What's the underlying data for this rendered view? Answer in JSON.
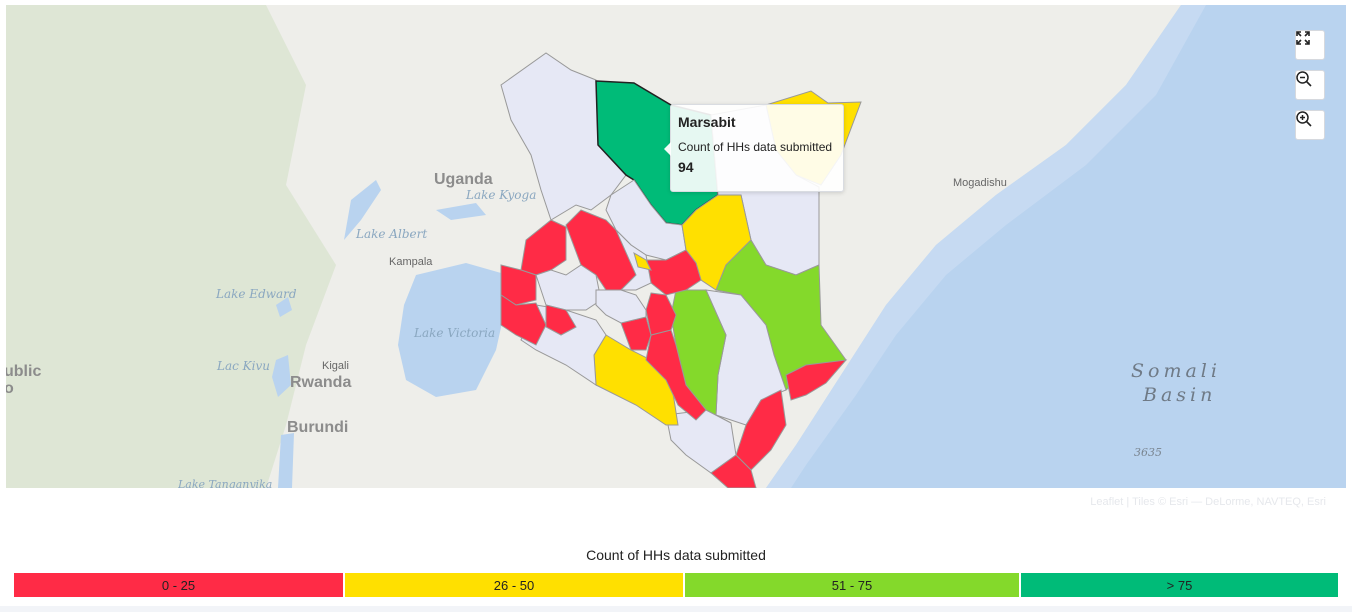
{
  "map": {
    "labels": {
      "uganda": "Uganda",
      "lake_kyoga": "Lake Kyoga",
      "lake_albert": "Lake Albert",
      "kampala": "Kampala",
      "lake_edward": "Lake Edward",
      "lake_victoria": "Lake Victoria",
      "public": "ublic",
      "public2": "o",
      "kigali": "Kigali",
      "rwanda": "Rwanda",
      "lac_kivu": "Lac Kivu",
      "burundi": "Burundi",
      "lake_tanganyika": "Lake Tanganyika",
      "mogadishu": "Mogadishu",
      "somali": "Somali",
      "basin": "Basin",
      "depth": "3635"
    },
    "attribution": "Leaflet | Tiles © Esri — DeLorme, NAVTEQ, Esri",
    "colors": {
      "low": "#ff2b46",
      "mid": "#ffe000",
      "high": "#84d92b",
      "top": "#00bb78",
      "nodata": "#e6e8f5",
      "land": "#eeeeea",
      "water": "#b9d3ef"
    }
  },
  "controls": {
    "fullscreen_icon": "expand-icon",
    "zoom_out_icon": "zoom-out-icon",
    "zoom_in_icon": "zoom-in-icon"
  },
  "tooltip": {
    "title": "Marsabit",
    "label": "Count of HHs data submitted",
    "value": "94"
  },
  "legend": {
    "title": "Count of HHs data submitted",
    "items": [
      {
        "label": "0 - 25",
        "color": "#ff2b46"
      },
      {
        "label": "26 - 50",
        "color": "#ffe000"
      },
      {
        "label": "51 - 75",
        "color": "#84d92b"
      },
      {
        "label": "> 75",
        "color": "#00bb78"
      }
    ]
  }
}
